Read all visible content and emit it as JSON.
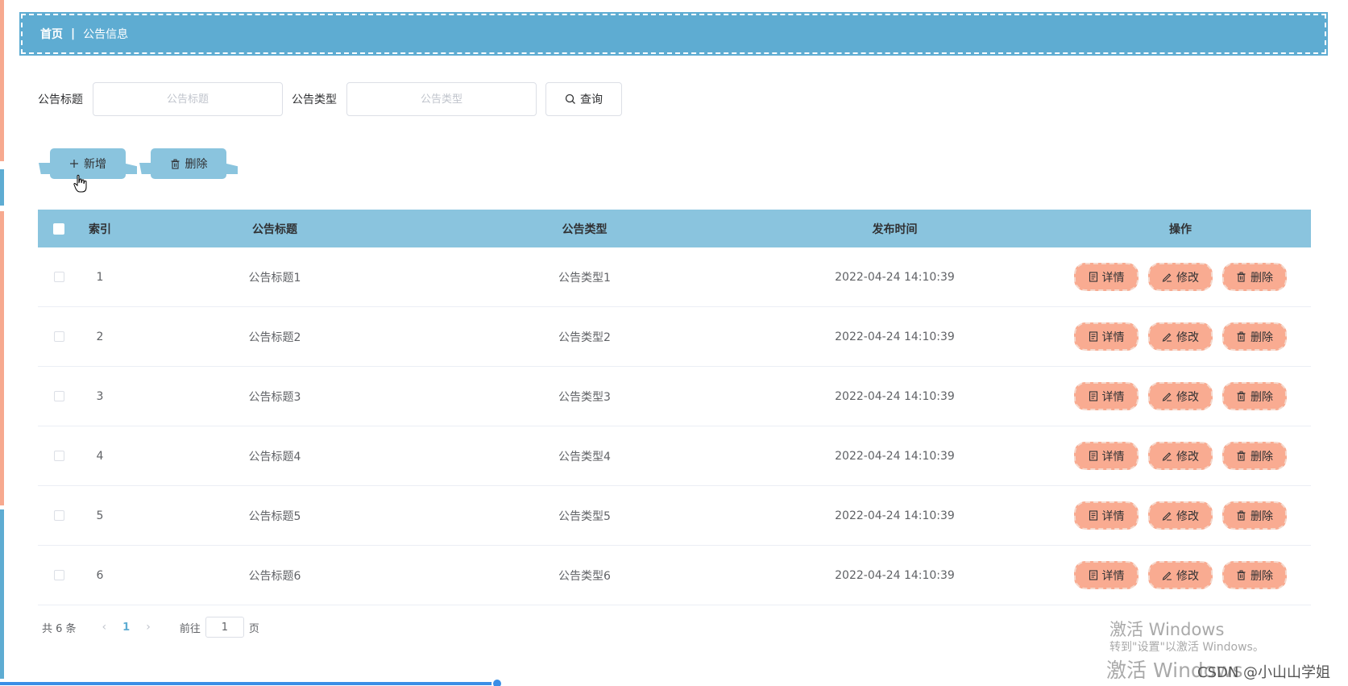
{
  "breadcrumb": {
    "home": "首页",
    "separator": "|",
    "current": "公告信息"
  },
  "search": {
    "title_label": "公告标题",
    "title_placeholder": "公告标题",
    "type_label": "公告类型",
    "type_placeholder": "公告类型",
    "query_button": "查询"
  },
  "toolbar": {
    "add_label": "新增",
    "delete_label": "删除"
  },
  "table": {
    "headers": {
      "index": "索引",
      "title": "公告标题",
      "type": "公告类型",
      "time": "发布时间",
      "ops": "操作"
    },
    "rows": [
      {
        "index": "1",
        "title": "公告标题1",
        "type": "公告类型1",
        "time": "2022-04-24 14:10:39"
      },
      {
        "index": "2",
        "title": "公告标题2",
        "type": "公告类型2",
        "time": "2022-04-24 14:10:39"
      },
      {
        "index": "3",
        "title": "公告标题3",
        "type": "公告类型3",
        "time": "2022-04-24 14:10:39"
      },
      {
        "index": "4",
        "title": "公告标题4",
        "type": "公告类型4",
        "time": "2022-04-24 14:10:39"
      },
      {
        "index": "5",
        "title": "公告标题5",
        "type": "公告类型5",
        "time": "2022-04-24 14:10:39"
      },
      {
        "index": "6",
        "title": "公告标题6",
        "type": "公告类型6",
        "time": "2022-04-24 14:10:39"
      }
    ],
    "row_actions": {
      "detail": "详情",
      "edit": "修改",
      "delete": "删除"
    }
  },
  "pagination": {
    "total": "共 6 条",
    "prev": "‹",
    "current_page": "1",
    "next": "›",
    "goto_label": "前往",
    "goto_value": "1",
    "page_suffix": "页"
  },
  "watermark": {
    "line1": "激活 Windows",
    "line2": "转到\"设置\"以激活 Windows。",
    "line3": "激活 Windows",
    "credit": "CSDN @小山山学姐"
  },
  "colors": {
    "header_bar": "#5eacd2",
    "table_header": "#8ac4de",
    "action_button": "#f9ab91",
    "accent": "#3a8ee6"
  },
  "icons": {
    "query": "search-icon",
    "add": "plus-icon",
    "delete": "trash-icon",
    "detail": "document-icon",
    "edit": "pencil-icon"
  }
}
